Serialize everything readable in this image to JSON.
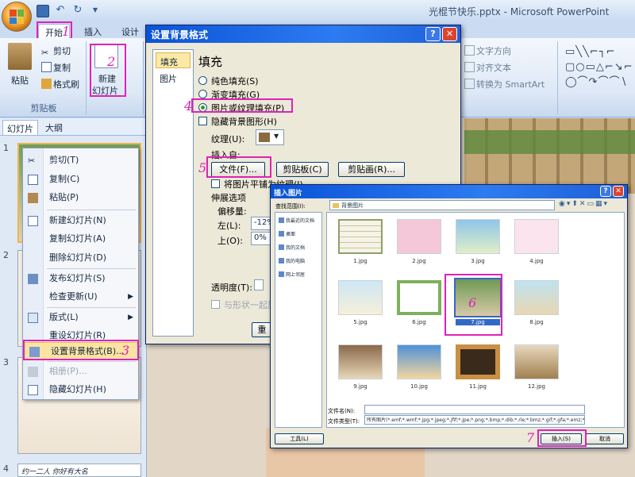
{
  "window": {
    "title": "光棍节快乐.pptx - Microsoft PowerPoint"
  },
  "ribbon": {
    "tabs": [
      "开始",
      "插入",
      "设计"
    ],
    "clipboard": {
      "paste": "粘贴",
      "cut": "剪切",
      "copy": "复制",
      "format_painter": "格式刷",
      "group_label": "剪贴板"
    },
    "slides": {
      "new_slide_line1": "新建",
      "new_slide_line2": "幻灯片"
    },
    "paragraph": {
      "text_direction": "文字方向",
      "align_text": "对齐文本",
      "convert_smartart": "转换为 SmartArt"
    }
  },
  "panel": {
    "tabs": [
      "幻灯片",
      "大纲"
    ],
    "slide_numbers": [
      "1",
      "2",
      "3",
      "4"
    ],
    "slide4_caption": "约一二人 你好有大名"
  },
  "context_menu": {
    "items": [
      {
        "label": "剪切(T)",
        "icon": "scissors-icon",
        "disabled": false
      },
      {
        "label": "复制(C)",
        "icon": "copy-icon",
        "disabled": false
      },
      {
        "label": "粘贴(P)",
        "icon": "paste-icon",
        "disabled": false
      },
      {
        "label": "新建幻灯片(N)",
        "icon": "new-slide-icon",
        "disabled": false
      },
      {
        "label": "复制幻灯片(A)",
        "icon": "duplicate-slide-icon",
        "disabled": false
      },
      {
        "label": "删除幻灯片(D)",
        "icon": "delete-slide-icon",
        "disabled": false
      },
      {
        "label": "发布幻灯片(S)",
        "icon": "publish-icon",
        "disabled": false
      },
      {
        "label": "检查更新(U)",
        "icon": "",
        "disabled": false,
        "submenu": true
      },
      {
        "label": "版式(L)",
        "icon": "layout-icon",
        "disabled": false,
        "submenu": true
      },
      {
        "label": "重设幻灯片(R)",
        "icon": "reset-icon",
        "disabled": false
      },
      {
        "label": "设置背景格式(B)...",
        "icon": "format-background-icon",
        "disabled": false
      },
      {
        "label": "相册(P)...",
        "icon": "album-icon",
        "disabled": true
      },
      {
        "label": "隐藏幻灯片(H)",
        "icon": "hide-slide-icon",
        "disabled": false
      }
    ]
  },
  "bg_dialog": {
    "title": "设置背景格式",
    "nav": [
      "填充",
      "图片"
    ],
    "section_title": "填充",
    "solid_fill": "纯色填充(S)",
    "gradient_fill": "渐变填充(G)",
    "picture_fill": "图片或纹理填充(P)",
    "hide_bg_graphics": "隐藏背景图形(H)",
    "texture_label": "纹理(U):",
    "insert_from": "插入自:",
    "file_btn": "文件(F)...",
    "clipboard_btn": "剪贴板(C)",
    "clipart_btn": "剪贴画(R)...",
    "tile_option": "将图片平铺为纹理(I)",
    "stretch_options": "伸展选项",
    "offset_label": "偏移量:",
    "left_label": "左(L):",
    "left_value": "-12%",
    "top_label": "上(O):",
    "top_value": "0%",
    "transparency_label": "透明度(T):",
    "rotate_with_shape": "与形状一起旋转(W)",
    "reset_btn": "重"
  },
  "pic_dialog": {
    "title": "插入图片",
    "lookin_label": "查找范围(I):",
    "lookin_value": "背景图片",
    "places": [
      "我最近的文档",
      "桌面",
      "我的文档",
      "我的电脑",
      "网上邻居"
    ],
    "files": [
      "1.jpg",
      "2.jpg",
      "3.jpg",
      "4.jpg",
      "5.jpg",
      "6.jpg",
      "7.jpg",
      "8.jpg",
      "9.jpg",
      "10.jpg",
      "11.jpg",
      "12.jpg"
    ],
    "selected_file": "7.jpg",
    "filename_label": "文件名(N):",
    "filetype_label": "文件类型(T):",
    "filetype_value": "所有图片(*.emf;*.wmf;*.jpg;*.jpeg;*.jfif;*.jpe;*.png;*.bmp;*.dib;*.rle;*.bmz;*.gif;*.gfa;*.emz;*.wmz;*.pcz;*.tif;*.tiff)",
    "tools_btn": "工具(L)",
    "insert_btn": "插入(S)",
    "cancel_btn": "取消"
  },
  "step_marks": [
    "1",
    "2",
    "3",
    "4",
    "5",
    "6",
    "7"
  ],
  "colors": {
    "highlight": "#e022b7",
    "title_bar": "#0a53d8"
  }
}
